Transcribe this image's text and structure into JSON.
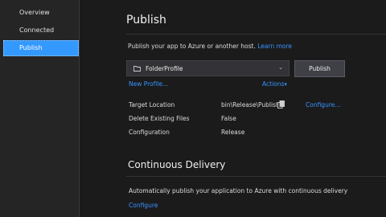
{
  "sidebar": {
    "items": [
      {
        "label": "Overview"
      },
      {
        "label": "Connected Services"
      },
      {
        "label": "Publish"
      }
    ]
  },
  "publish": {
    "title": "Publish",
    "subtitle": "Publish your app to Azure or another host.",
    "learn_more": "Learn more",
    "profile_value": "FolderProfile",
    "publish_button": "Publish",
    "new_profile": "New Profile...",
    "actions": "Actions",
    "configure_link": "Configure...",
    "rows": [
      {
        "label": "Target Location",
        "value": "bin\\Release\\Publish"
      },
      {
        "label": "Delete Existing Files",
        "value": "False"
      },
      {
        "label": "Configuration",
        "value": "Release"
      }
    ]
  },
  "continuous_delivery": {
    "title": "Continuous Delivery",
    "text": "Automatically publish your application to Azure with continuous delivery",
    "configure": "Configure"
  },
  "colors": {
    "accent": "#3399ff",
    "link": "#3794ff",
    "background": "#1b1b1c",
    "sidebar": "#252526"
  },
  "icons": [
    "folder-icon",
    "chevron-down-icon",
    "copy-icon",
    "triangle-down-icon"
  ]
}
